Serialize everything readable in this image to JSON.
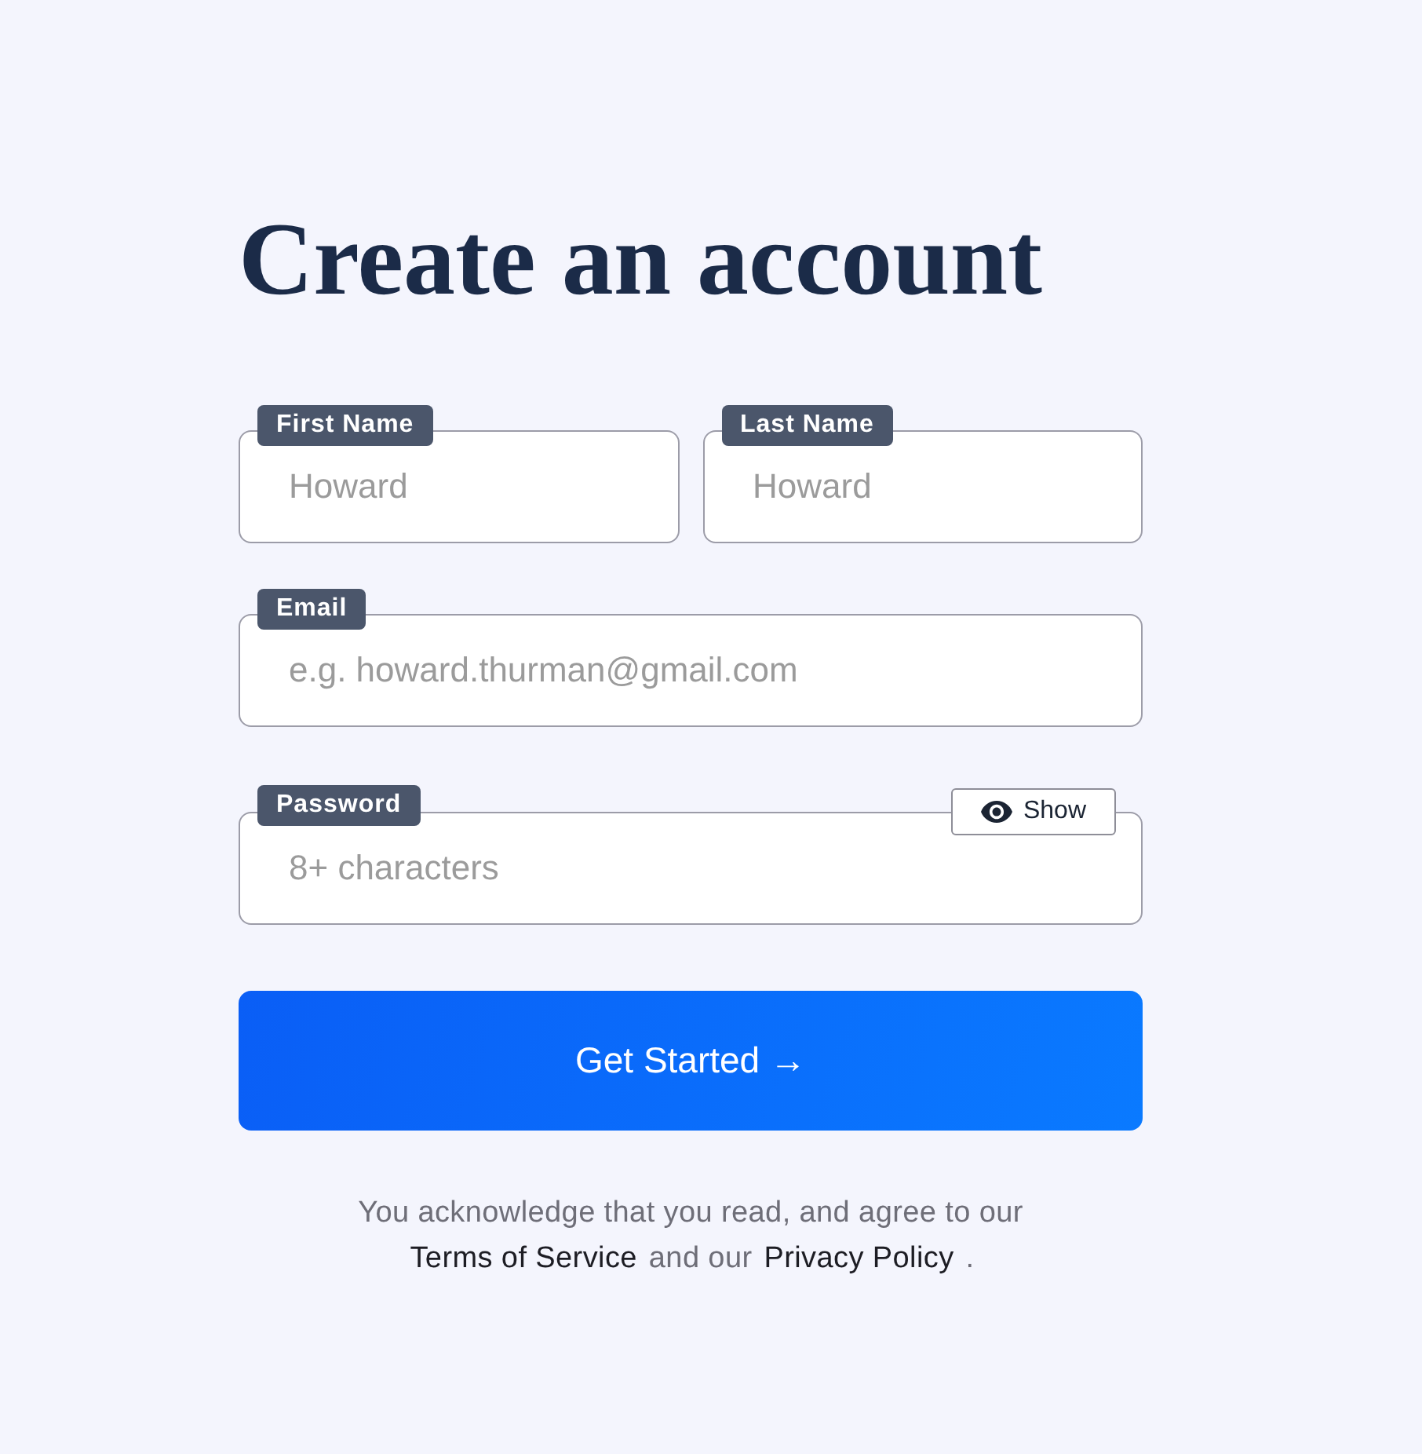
{
  "heading": "Create an account",
  "rows": [
    {
      "fields": [
        {
          "label": "First Name",
          "placeholder": "Howard"
        },
        {
          "label": "Last Name",
          "placeholder": "Howard"
        }
      ]
    },
    {
      "fields": [
        {
          "label": "Email",
          "placeholder": "e.g. howard.thurman@gmail.com"
        }
      ]
    },
    {
      "fields": [
        {
          "label": "Password",
          "placeholder": "8+ characters",
          "toggle": {
            "label": "Show"
          }
        }
      ]
    }
  ],
  "submit_button": {
    "label": "Get Started →"
  },
  "legal": {
    "parts": [
      {
        "kind": "text",
        "text": "You acknowledge that you read, and agree to our"
      },
      {
        "kind": "link",
        "text": "Terms of Service"
      },
      {
        "kind": "text",
        "text": "and our"
      },
      {
        "kind": "link",
        "text": "Privacy Policy"
      },
      {
        "kind": "text",
        "text": "."
      }
    ]
  }
}
